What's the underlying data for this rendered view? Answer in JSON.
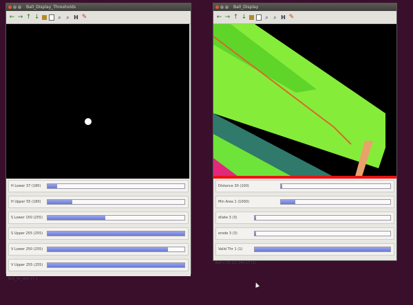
{
  "left_window": {
    "title": "Ball_Display_Thresholds",
    "sliders": [
      {
        "label": "H Lower 37 (180)",
        "fraction": 0.07
      },
      {
        "label": "H Upper 55 (180)",
        "fraction": 0.18
      },
      {
        "label": "S Lower 150 (255)",
        "fraction": 0.42
      },
      {
        "label": "S Upper 255 (255)",
        "fraction": 1.0
      },
      {
        "label": "V Lower 250 (255)",
        "fraction": 0.88
      },
      {
        "label": "V Upper 255 (255)",
        "fraction": 1.0
      }
    ],
    "status": "Ball_Xs_size 17 1"
  },
  "right_window": {
    "title": "Ball_Display",
    "sliders": [
      {
        "label": "Distance 30 (100)",
        "fraction": 0.01
      },
      {
        "label": "Min Area 1 (1000)",
        "fraction": 0.13
      },
      {
        "label": "dilate 3 (3)",
        "fraction": 0.01
      },
      {
        "label": "erode 3 (3)",
        "fraction": 0.01
      },
      {
        "label": "Valid Thr 1 (1)",
        "fraction": 1.0
      }
    ],
    "status": "Ball x 30 1/x 240 17 (1)"
  },
  "toolbar_icons": [
    "arrow-left-icon",
    "arrow-right-icon",
    "arrow-up-icon",
    "arrow-down-icon",
    "save-icon",
    "page-icon",
    "zoom-in-icon",
    "zoom-out-icon",
    "h-icon",
    "pen-icon"
  ],
  "colors": {
    "desktop": "#3a0f2c",
    "field_green": "#7ef03a",
    "fill_blue": "#6a78d8"
  }
}
